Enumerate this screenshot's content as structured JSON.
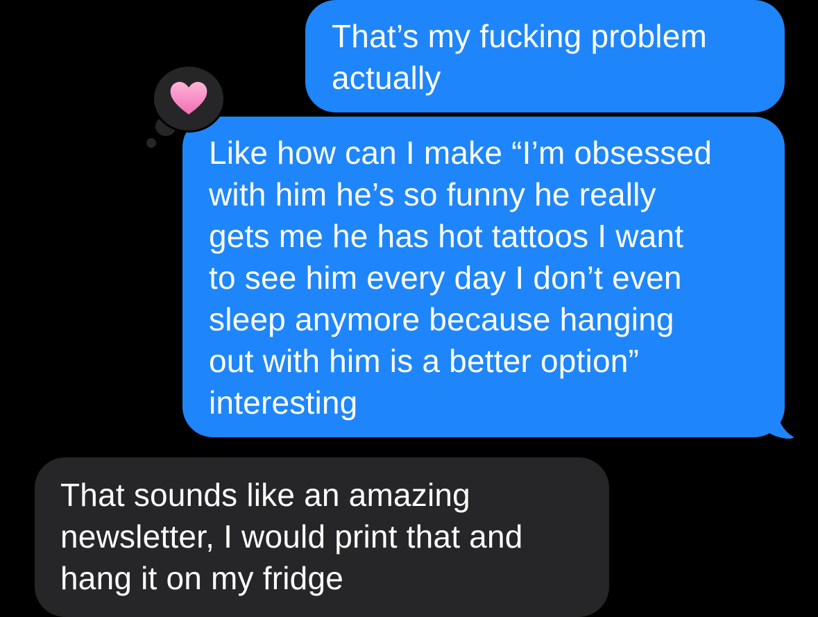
{
  "conversation": {
    "messages": [
      {
        "sender": "me",
        "text": "That’s my fucking problem\nactually"
      },
      {
        "sender": "me",
        "text": "Like how can I make “I’m obsessed\nwith him he’s so funny he really\ngets me he has hot tattoos I want\nto see him every day I don’t even\nsleep anymore because hanging\nout with him is a better option”\ninteresting"
      },
      {
        "sender": "them",
        "text": "That sounds like an amazing\nnewsletter, I would print that and\nhang it on my fridge"
      }
    ],
    "reaction": {
      "icon": "heart-icon",
      "color": "#f58bc6"
    }
  },
  "colors": {
    "background": "#000000",
    "sent_bubble": "#1e86fa",
    "received_bubble": "#262628",
    "text": "#ffffff"
  }
}
